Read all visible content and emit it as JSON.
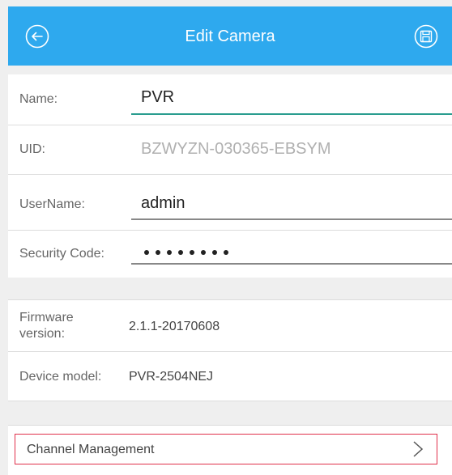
{
  "header": {
    "title": "Edit Camera",
    "back_icon": "back-arrow-circle-icon",
    "save_icon": "floppy-save-circle-icon"
  },
  "fields": {
    "name": {
      "label": "Name:",
      "value": "PVR"
    },
    "uid": {
      "label": "UID:",
      "value": "BZWYZN-030365-EBSYM"
    },
    "username": {
      "label": "UserName:",
      "value": "admin"
    },
    "security": {
      "label": "Security Code:",
      "masked_length": 8
    }
  },
  "info": {
    "firmware": {
      "label": "Firmware version:",
      "value": "2.1.1-20170608"
    },
    "model": {
      "label": "Device model:",
      "value": "PVR-2504NEJ"
    }
  },
  "menu": {
    "channel_management": "Channel Management",
    "chevron_icon": "chevron-right-icon"
  },
  "colors": {
    "header": "#2ea9ee",
    "active_underline": "#2a9d8f",
    "highlight_border": "#e0304a",
    "background": "#efefef"
  }
}
